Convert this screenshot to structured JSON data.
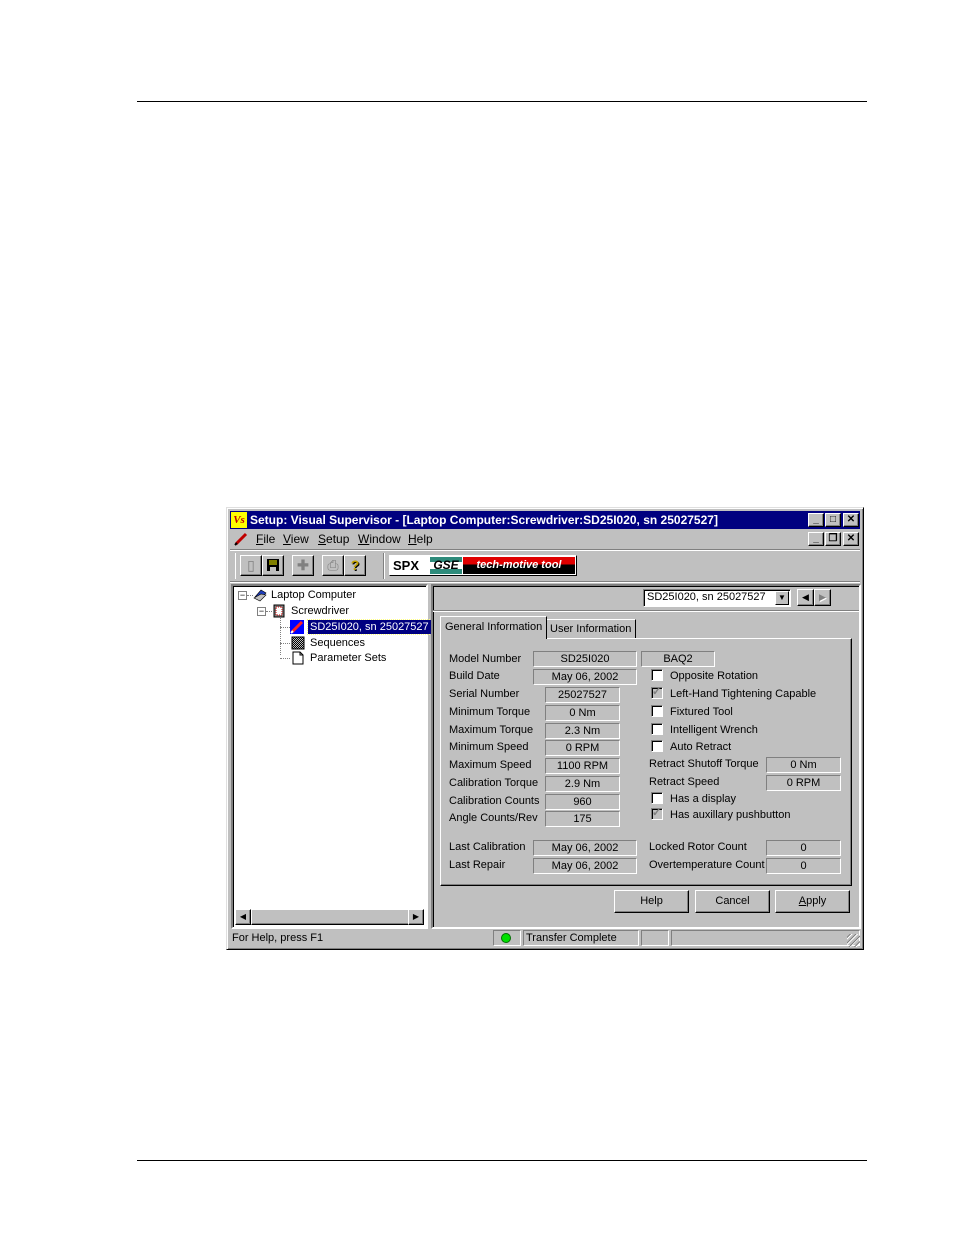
{
  "window": {
    "app_icon": "Vs",
    "title": "Setup: Visual Supervisor - [Laptop Computer:Screwdriver:SD25I020, sn 25027527]",
    "caption_buttons": [
      "minimize",
      "maximize",
      "close"
    ],
    "mdi_buttons": [
      "minimize",
      "restore",
      "close"
    ]
  },
  "menubar": {
    "items": [
      {
        "label": "File",
        "accel": "F"
      },
      {
        "label": "View",
        "accel": "V"
      },
      {
        "label": "Setup",
        "accel": "S"
      },
      {
        "label": "Window",
        "accel": "W"
      },
      {
        "label": "Help",
        "accel": "H"
      }
    ]
  },
  "toolbar": {
    "buttons": [
      {
        "icon": "device-icon",
        "enabled": false
      },
      {
        "icon": "save-icon",
        "enabled": true
      },
      {
        "icon": "add-icon",
        "enabled": false
      },
      {
        "icon": "print-icon",
        "enabled": false
      },
      {
        "icon": "help-icon",
        "enabled": true
      }
    ],
    "logo": {
      "spx": "SPX",
      "gse": "GSE",
      "tagline": "tech-motive tool"
    }
  },
  "tree": {
    "nodes": [
      {
        "label": "Laptop Computer",
        "icon": "laptop-icon",
        "expanded": true,
        "level": 0
      },
      {
        "label": "Screwdriver",
        "icon": "controller-icon",
        "expanded": true,
        "level": 1
      },
      {
        "label": "SD25I020, sn 25027527",
        "icon": "tool-icon",
        "level": 2,
        "selected": true
      },
      {
        "label": "Sequences",
        "icon": "sequences-icon",
        "level": 2
      },
      {
        "label": "Parameter Sets",
        "icon": "document-icon",
        "level": 2
      }
    ]
  },
  "tool_selector": {
    "value": "SD25I020, sn 25027527"
  },
  "tabs": [
    {
      "label": "General Information",
      "active": true
    },
    {
      "label": "User Information",
      "active": false
    }
  ],
  "general": {
    "model_number": {
      "label": "Model Number",
      "value": "SD25I020",
      "extra": "BAQ2"
    },
    "build_date": {
      "label": "Build Date",
      "value": "May 06, 2002"
    },
    "serial_number": {
      "label": "Serial Number",
      "value": "25027527"
    },
    "min_torque": {
      "label": "Minimum Torque",
      "value": "0 Nm"
    },
    "max_torque": {
      "label": "Maximum Torque",
      "value": "2.3 Nm"
    },
    "min_speed": {
      "label": "Minimum Speed",
      "value": "0 RPM"
    },
    "max_speed": {
      "label": "Maximum Speed",
      "value": "1100 RPM"
    },
    "cal_torque": {
      "label": "Calibration Torque",
      "value": "2.9 Nm"
    },
    "cal_counts": {
      "label": "Calibration Counts",
      "value": "960"
    },
    "angle_counts": {
      "label": "Angle Counts/Rev",
      "value": "175"
    },
    "last_calibration": {
      "label": "Last Calibration",
      "value": "May 06, 2002"
    },
    "last_repair": {
      "label": "Last Repair",
      "value": "May 06, 2002"
    },
    "checkboxes": [
      {
        "label": "Opposite Rotation",
        "checked": false
      },
      {
        "label": "Left-Hand Tightening Capable",
        "checked": true
      },
      {
        "label": "Fixtured Tool",
        "checked": false
      },
      {
        "label": "Intelligent Wrench",
        "checked": false
      },
      {
        "label": "Auto Retract",
        "checked": false
      }
    ],
    "retract_torque": {
      "label": "Retract Shutoff Torque",
      "value": "0 Nm"
    },
    "retract_speed": {
      "label": "Retract Speed",
      "value": "0 RPM"
    },
    "checkboxes2": [
      {
        "label": "Has a display",
        "checked": false
      },
      {
        "label": "Has auxillary pushbutton",
        "checked": true
      }
    ],
    "locked_rotor": {
      "label": "Locked Rotor Count",
      "value": "0"
    },
    "overtemp": {
      "label": "Overtemperature Count",
      "value": "0"
    }
  },
  "buttons": {
    "help": "Help",
    "cancel": "Cancel",
    "apply": "Apply"
  },
  "statusbar": {
    "help_text": "For Help, press F1",
    "led_color": "#00e000",
    "status": "Transfer Complete"
  }
}
